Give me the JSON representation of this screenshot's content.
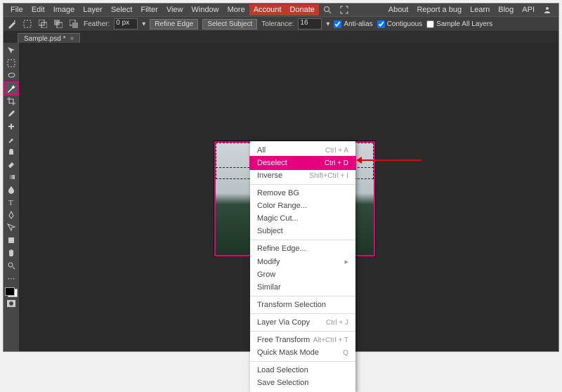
{
  "menu": {
    "items": [
      "File",
      "Edit",
      "Image",
      "Layer",
      "Select",
      "Filter",
      "View",
      "Window",
      "More"
    ],
    "account": "Account",
    "donate": "Donate",
    "right": [
      "About",
      "Report a bug",
      "Learn",
      "Blog",
      "API"
    ]
  },
  "opt": {
    "feather_lbl": "Feather:",
    "feather_val": "0 px",
    "refine": "Refine Edge",
    "selsubj": "Select Subject",
    "tol_lbl": "Tolerance:",
    "tol_val": "16",
    "aa": "Anti-alias",
    "contig": "Contiguous",
    "sal": "Sample All Layers"
  },
  "tab": {
    "name": "Sample.psd *",
    "close": "×"
  },
  "tools": [
    "move",
    "marquee",
    "lasso",
    "wand",
    "crop",
    "eyedropper",
    "brush",
    "clone",
    "eraser",
    "gradient",
    "blur",
    "text",
    "pen",
    "path",
    "shape",
    "hand",
    "zoom"
  ],
  "ctx": {
    "all": {
      "l": "All",
      "s": "Ctrl + A"
    },
    "deselect": {
      "l": "Deselect",
      "s": "Ctrl + D"
    },
    "inverse": {
      "l": "Inverse",
      "s": "Shift+Ctrl + I"
    },
    "removebg": {
      "l": "Remove BG"
    },
    "colorrange": {
      "l": "Color Range..."
    },
    "magiccut": {
      "l": "Magic Cut..."
    },
    "subject": {
      "l": "Subject"
    },
    "refine": {
      "l": "Refine Edge..."
    },
    "modify": {
      "l": "Modify"
    },
    "grow": {
      "l": "Grow"
    },
    "similar": {
      "l": "Similar"
    },
    "transform": {
      "l": "Transform Selection"
    },
    "layervia": {
      "l": "Layer Via Copy",
      "s": "Ctrl + J"
    },
    "freet": {
      "l": "Free Transform",
      "s": "Alt+Ctrl + T"
    },
    "qmask": {
      "l": "Quick Mask Mode",
      "s": "Q"
    },
    "load": {
      "l": "Load Selection"
    },
    "save": {
      "l": "Save Selection"
    }
  }
}
